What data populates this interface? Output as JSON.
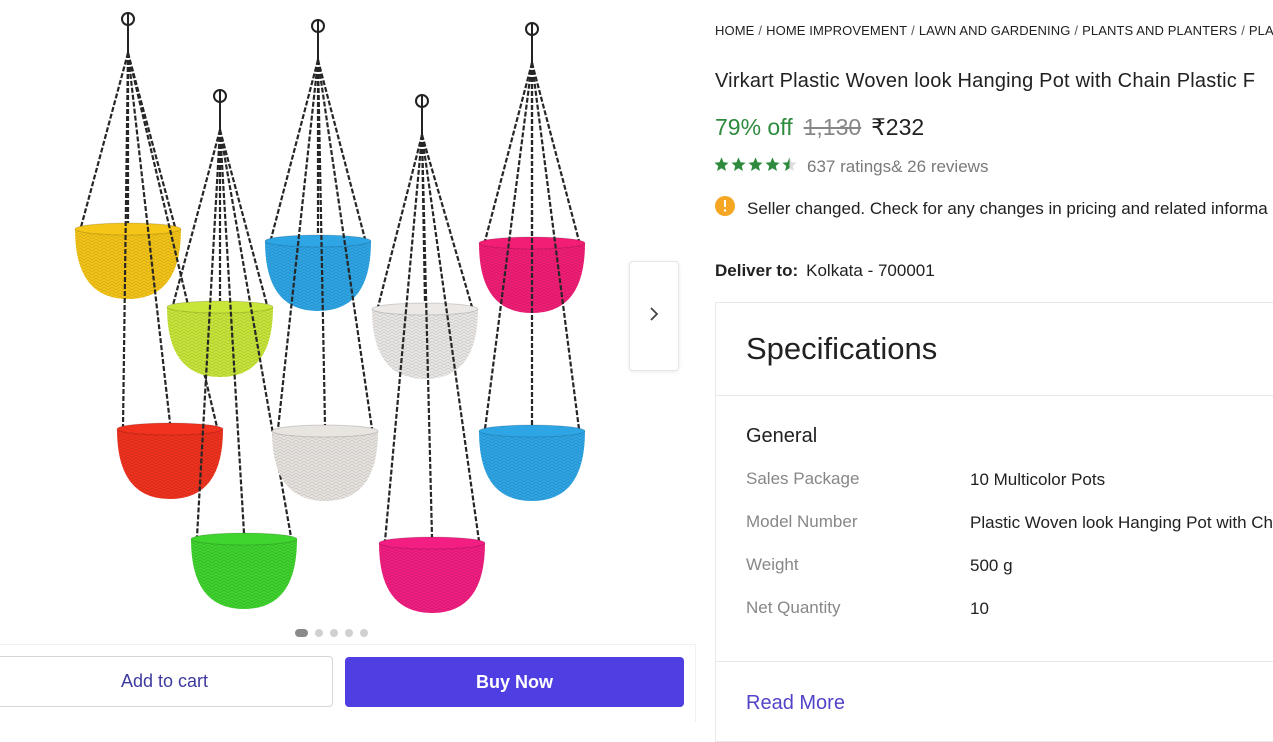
{
  "gallery": {
    "image_alt": "10 multicolor hanging pots with chains",
    "dots_count": 5,
    "active_dot": 1
  },
  "actions": {
    "add_to_cart": "Add to cart",
    "buy_now": "Buy Now"
  },
  "breadcrumb": [
    "HOME",
    "HOME IMPROVEMENT",
    "LAWN AND GARDENING",
    "PLANTS AND PLANTERS",
    "PLANT C"
  ],
  "product": {
    "title": "Virkart Plastic Woven look Hanging Pot with Chain Plastic F",
    "discount": "79% off",
    "mrp": "1,130",
    "price": "₹232",
    "rating_value": 4.3,
    "ratings": "637 ratings",
    "reviews": "& 26 reviews",
    "notice": "Seller changed. Check for any changes in pricing and related informa"
  },
  "delivery": {
    "label": "Deliver to:",
    "location": "Kolkata - 700001"
  },
  "specifications": {
    "title": "Specifications",
    "group": "General",
    "rows": [
      {
        "key": "Sales Package",
        "value": "10 Multicolor Pots"
      },
      {
        "key": "Model Number",
        "value": "Plastic Woven look Hanging Pot with Ch"
      },
      {
        "key": "Weight",
        "value": "500 g"
      },
      {
        "key": "Net Quantity",
        "value": "10"
      }
    ],
    "read_more": "Read More"
  },
  "colors": {
    "discount_green": "#2e8b3d",
    "star_green": "#2e8b3d",
    "buy_button": "#4f3ee1",
    "link_purple": "#5144c7",
    "notice_icon": "#f5a623"
  },
  "icons": {
    "next": "chevron-right-icon",
    "notice": "info-icon",
    "star": "star-icon"
  }
}
